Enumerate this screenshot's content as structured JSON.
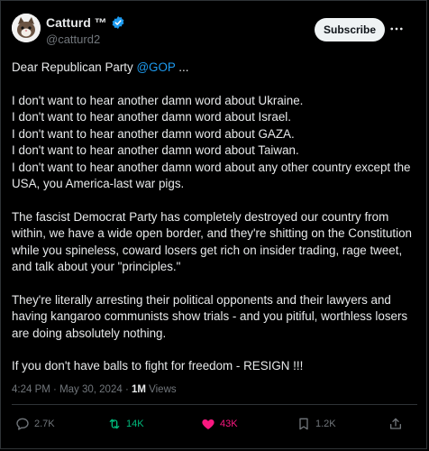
{
  "author": {
    "name": "Catturd ™",
    "handle": "@catturd2"
  },
  "header": {
    "subscribe_label": "Subscribe"
  },
  "post": {
    "greeting_prefix": "Dear Republican Party ",
    "greeting_mention": "@GOP",
    "greeting_suffix": " ...",
    "lines": [
      "I don't want to hear another damn word about Ukraine.",
      "I don't want to hear another damn word about Israel.",
      "I don't want to hear another damn word about GAZA.",
      "I don't want to hear another damn word about Taiwan.",
      "I don't want to hear another damn word about any other country except the USA, you America-last war pigs."
    ],
    "paragraph2": "The fascist Democrat Party has completely destroyed our country from within, we have a wide open border, and they're shitting on the Constitution while you spineless, coward losers get rich on insider trading, rage tweet, and talk about your \"principles.\"",
    "paragraph3": "They're literally arresting their political opponents and their lawyers and having kangaroo communists show trials - and you pitiful, worthless losers are doing absolutely nothing.",
    "paragraph4": "If you don't have balls to fight for freedom - RESIGN !!!"
  },
  "meta": {
    "time": "4:24 PM",
    "separator": " · ",
    "date": "May 30, 2024",
    "views_count": "1M",
    "views_label": " Views"
  },
  "actions": {
    "replies": "2.7K",
    "retweets": "14K",
    "likes": "43K",
    "bookmarks": "1.2K"
  },
  "icons": {
    "verified": "verified-badge-icon",
    "more": "more-icon",
    "reply": "reply-icon",
    "retweet": "retweet-icon",
    "like": "heart-icon",
    "bookmark": "bookmark-icon",
    "share": "share-icon"
  },
  "colors": {
    "background": "#000000",
    "text": "#e7e9ea",
    "secondary": "#71767b",
    "accent": "#1d9bf0",
    "retweet": "#00ba7c",
    "like": "#f91880"
  }
}
